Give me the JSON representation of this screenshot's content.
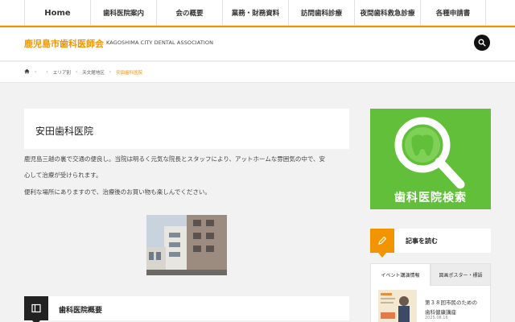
{
  "nav": {
    "items": [
      {
        "label": "Home"
      },
      {
        "label": "歯科医院案内"
      },
      {
        "label": "会の概要"
      },
      {
        "label": "業務・財務資料"
      },
      {
        "label": "訪問歯科診療"
      },
      {
        "label": "夜間歯科救急診療"
      },
      {
        "label": "各種申請書"
      }
    ]
  },
  "header": {
    "site_title": "鹿児島市歯科医師会",
    "site_description": "KAGOSHIMA CITY DENTAL ASSOCIATION",
    "search_icon": "search-icon"
  },
  "breadcrumb": {
    "home_icon": "home-icon",
    "items": [
      "エリア別",
      "天文館地区"
    ],
    "current": "安田歯科医院"
  },
  "main": {
    "page_title": "安田歯科医院",
    "paragraph_line1": "鹿児島三越の裏で交通の便良し。当院は明るく元気な院長とスタッフにより、アットホームな雰囲気の中で、安",
    "paragraph_line2": "心して治療が受けられます。",
    "paragraph_line3": "便利な場所にありますので、治療後のお買い物も楽しんでください。",
    "photo": "building-photo",
    "section_title": "歯科医院概要",
    "section_icon": "book-icon"
  },
  "sidebar": {
    "banner_label": "歯科医院検索",
    "banner_icon": "magnifier-icon",
    "read_title": "記事を読む",
    "read_icon": "pencil-icon",
    "tabs": [
      {
        "label": "イベント講演情報",
        "active": true
      },
      {
        "label": "図画ポスター・標語",
        "active": false
      }
    ],
    "news": {
      "title_line1": "第３８回市民のための",
      "title_line2": "歯科健康講座",
      "date": "2025.08.16"
    }
  },
  "colors": {
    "accent": "#f29400",
    "banner_green": "#61bf3a",
    "dark": "#222222"
  }
}
